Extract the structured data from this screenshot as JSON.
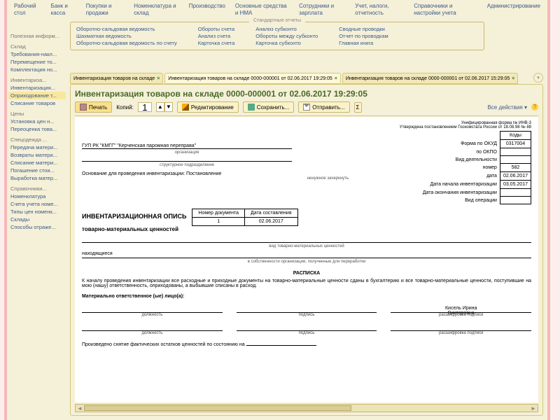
{
  "topmenu": [
    "Рабочий\nстол",
    "Банк и\nкасса",
    "Покупки и\nпродажи",
    "Номенклатура\nи склад",
    "Производство",
    "Основные\nсредства и НМА",
    "Сотрудники\nи зарплата",
    "Учет, налоги,\nотчетность",
    "Справочники и\nнастройки учета",
    "Администрирование"
  ],
  "reports": {
    "header": "Стандартные отчеты",
    "cols": [
      [
        "Оборотно-сальдовая ведомость",
        "Шахматная ведомость",
        "Оборотно-сальдовая ведомость по счету"
      ],
      [
        "Обороты счета",
        "Анализ счета",
        "Карточка счета"
      ],
      [
        "Анализ субконто",
        "Обороты между субконто",
        "Карточка субконто"
      ],
      [
        "Сводные проводки",
        "Отчет по проводкам",
        "Главная книга"
      ]
    ]
  },
  "leftnav": [
    {
      "t": "Полезная информ...",
      "g": true
    },
    {
      "t": "Склад",
      "g": true
    },
    {
      "t": "Требования-накл..."
    },
    {
      "t": "Перемещение то..."
    },
    {
      "t": "Комплектация но..."
    },
    {
      "t": "Инвентариза...",
      "g": true
    },
    {
      "t": "Инвентаризация..."
    },
    {
      "t": "Оприходование т...",
      "sel": true
    },
    {
      "t": "Списание товаров"
    },
    {
      "t": "Цены",
      "g": true
    },
    {
      "t": "Установка цен н..."
    },
    {
      "t": "Переоценка това..."
    },
    {
      "t": "Спецодежда ...",
      "g": true
    },
    {
      "t": "Передача матери..."
    },
    {
      "t": "Возвраты матери..."
    },
    {
      "t": "Списание матери..."
    },
    {
      "t": "Погашение стои..."
    },
    {
      "t": "Выработка матер..."
    },
    {
      "t": "Справочники...",
      "g": true
    },
    {
      "t": "Номенклатура"
    },
    {
      "t": "Счета учета номе..."
    },
    {
      "t": "Типы цен номенк..."
    },
    {
      "t": "Склады"
    },
    {
      "t": "Способы отраже..."
    }
  ],
  "tabs": [
    {
      "label": "Инвентаризация товаров на складе"
    },
    {
      "label": "Инвентаризация товаров на складе 0000-000001 от 02.06.2017 19:29:05",
      "act": true
    },
    {
      "label": "Инвентаризация товаров на складе 0000-000001 от 02.06.2017 15:29:05"
    }
  ],
  "doc": {
    "title": "Инвентаризация товаров на складе 0000-000001 от 02.06.2017 19:29:05",
    "toolbar": {
      "print": "Печать",
      "copies": "Копий:",
      "edit": "Редактирование",
      "save": "Сохранить...",
      "send": "Отправить...",
      "allactions": "Все действия ▾"
    },
    "form": {
      "formno": "Унифицированная форма № ИНВ-3",
      "approved": "Утверждена постановлением Госкомстата России от 18.08.98 № 88",
      "org": "ГУП РК \"КМГГ\"  \"Керченская паромная переправа\"",
      "orglabel": "организация",
      "subdiv": "структурное подразделение",
      "basis_lbl": "Основание для проведения инвентаризации:",
      "basis_val": "Постановление",
      "codes": {
        "hdr": "Коды",
        "okud_lbl": "Форма по ОКУД",
        "okud": "0317004",
        "okpo_lbl": "по ОКПО",
        "okpo": "",
        "activity_lbl": "Вид деятельности",
        "num_lbl": "номер",
        "num": "582",
        "date_lbl": "дата",
        "date": "02.06.2017",
        "start_lbl": "Дата начала инвентаризации",
        "start": "03.05.2017",
        "end_lbl": "Дата окончания инвентаризации",
        "end": "",
        "oper_lbl": "Вид операции",
        "oper": ""
      },
      "inv_title": "ИНВЕНТАРИЗАЦИОННАЯ ОПИСЬ",
      "inv_sub": "товарно-материальных ценностей",
      "mini": {
        "h1": "Номер документа",
        "h2": "Дата составления",
        "v1": "1",
        "v2": "02.06.2017"
      },
      "loc_lbl": "находящиеся",
      "loc_sub": "в собственности организации, полученные для переработки",
      "raspiska": "РАСПИСКА",
      "rasp_text": "К началу проведения инвентаризации все расходные и приходные документы на товарно-материальные ценности сданы в бухгалтерию и все товарно-материальные ценности, поступившие на мою (нашу) ответственность, оприходованы, а выбывшие списаны в расход.",
      "resp_lbl": "Материально ответственное (ые) лицо(а):",
      "sig": {
        "pos": "должность",
        "sign": "подпись",
        "name": "расшифровка подписи",
        "person": "Кисель Ирина\nВикторовна"
      },
      "footer": "Произведено снятие фактических остатков ценностей по состоянию на"
    }
  }
}
